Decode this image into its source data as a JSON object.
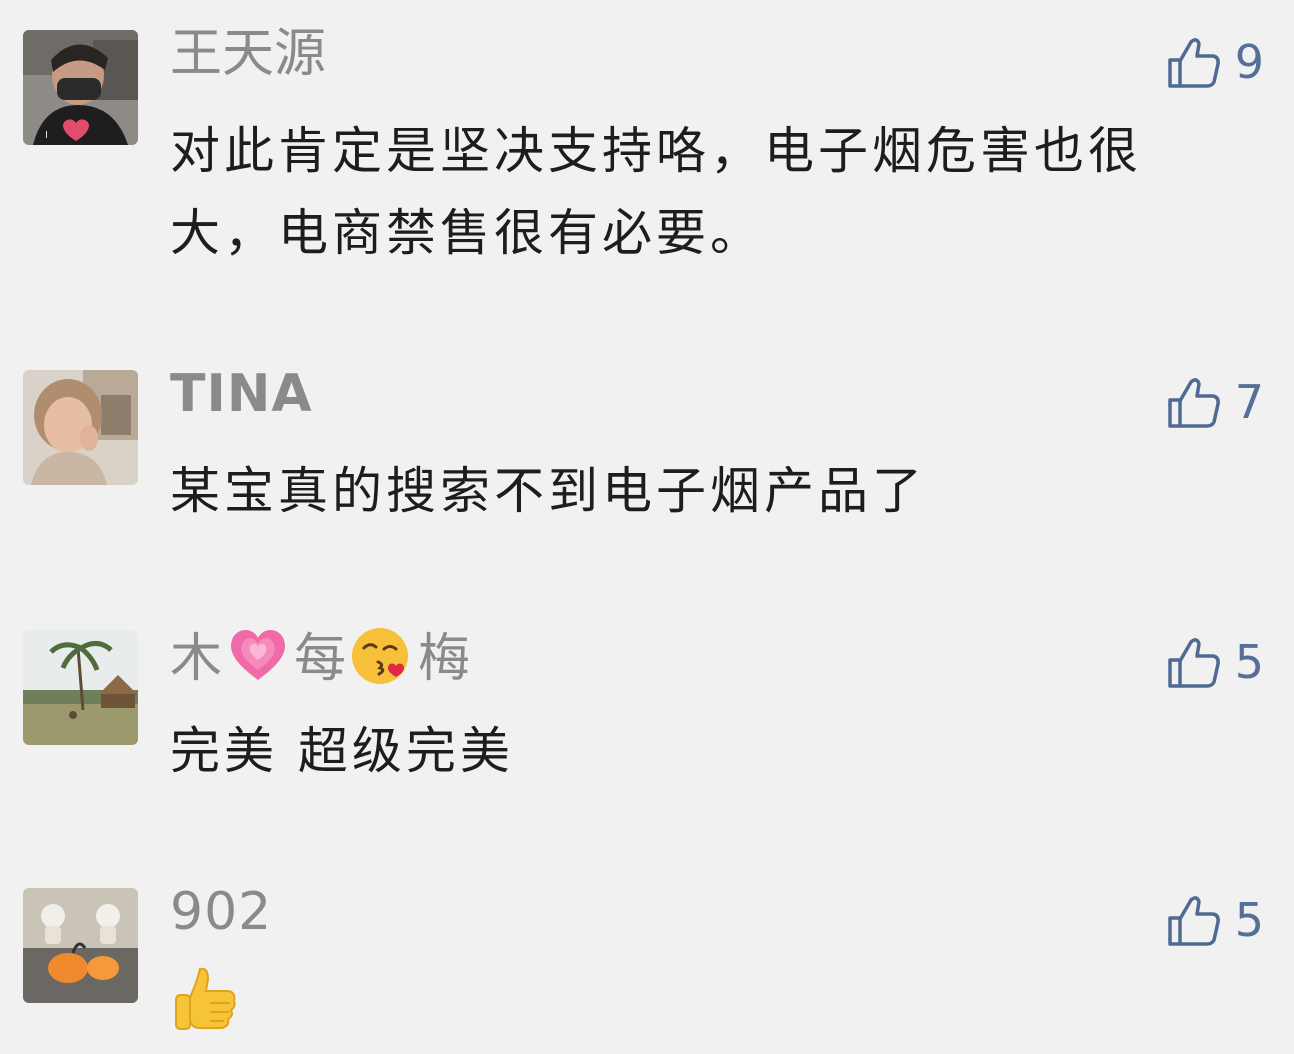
{
  "comments": [
    {
      "author": "王天源",
      "likes": "9",
      "text": "对此肯定是坚决支持咯，电子烟危害也很大，电商禁售很有必要。",
      "avatar_icon": "person-mask-avatar"
    },
    {
      "author": "TINA",
      "likes": "7",
      "text": "某宝真的搜索不到电子烟产品了",
      "avatar_icon": "woman-avatar"
    },
    {
      "author_parts": [
        "木",
        "每",
        "梅"
      ],
      "author_emoji": [
        "growing-heart-emoji",
        "kissing-face-emoji"
      ],
      "likes": "5",
      "text": "完美 超级完美",
      "avatar_icon": "beach-avatar"
    },
    {
      "author": "902",
      "likes": "5",
      "text": "",
      "reaction_icon": "thumbs-up-emoji",
      "avatar_icon": "toy-figures-avatar"
    }
  ],
  "colors": {
    "background": "#f1f1f1",
    "author": "#8a8a8a",
    "like_icon": "#4f6a92",
    "text": "#1d1d1d"
  }
}
